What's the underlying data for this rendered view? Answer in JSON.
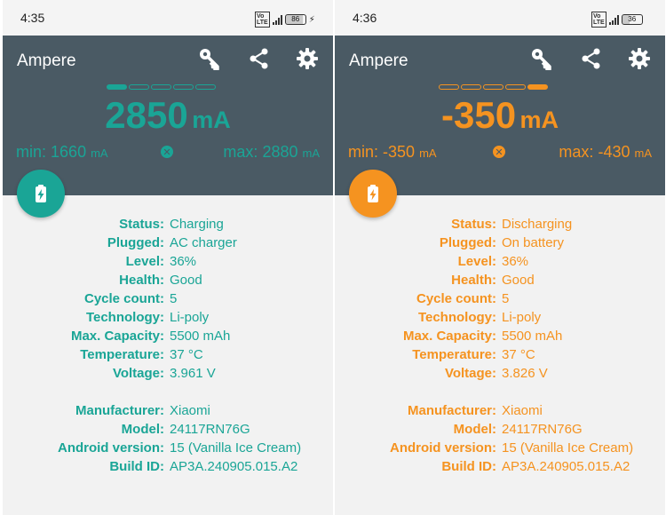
{
  "screens": [
    {
      "status_time": "4:35",
      "battery_indicator": "86",
      "battery_level_fraction": 0.86,
      "app_title": "Ampere",
      "accent": "#1aa596",
      "level_segments_filled": 1,
      "current_value": "2850",
      "current_unit": "mA",
      "min_label": "min:",
      "min_value": "1660",
      "min_unit": "mA",
      "max_label": "max:",
      "max_value": "2880",
      "max_unit": "mA",
      "status": "Charging",
      "plugged": "AC charger",
      "level": "36%",
      "health": "Good",
      "cycle_count": "5",
      "technology": "Li-poly",
      "max_capacity": "5500 mAh",
      "temperature": "37 °C",
      "voltage": "3.961 V",
      "manufacturer": "Xiaomi",
      "model": "24117RN76G",
      "android_version": "15 (Vanilla Ice Cream)",
      "build_id": "AP3A.240905.015.A2"
    },
    {
      "status_time": "4:36",
      "battery_indicator": "36",
      "battery_level_fraction": 0.36,
      "app_title": "Ampere",
      "accent": "#f59320",
      "level_segments_filled": 1,
      "current_value": "-350",
      "current_unit": "mA",
      "min_label": "min:",
      "min_value": "-350",
      "min_unit": "mA",
      "max_label": "max:",
      "max_value": "-430",
      "max_unit": "mA",
      "status": "Discharging",
      "plugged": "On battery",
      "level": "36%",
      "health": "Good",
      "cycle_count": "5",
      "technology": "Li-poly",
      "max_capacity": "5500 mAh",
      "temperature": "37 °C",
      "voltage": "3.826 V",
      "manufacturer": "Xiaomi",
      "model": "24117RN76G",
      "android_version": "15 (Vanilla Ice Cream)",
      "build_id": "AP3A.240905.015.A2"
    }
  ],
  "labels": {
    "status": "Status:",
    "plugged": "Plugged:",
    "level": "Level:",
    "health": "Health:",
    "cycle_count": "Cycle count:",
    "technology": "Technology:",
    "max_capacity": "Max. Capacity:",
    "temperature": "Temperature:",
    "voltage": "Voltage:",
    "manufacturer": "Manufacturer:",
    "model": "Model:",
    "android_version": "Android version:",
    "build_id": "Build ID:"
  },
  "icons": {
    "key": "key-icon",
    "share": "share-icon",
    "settings": "gear-icon",
    "reset": "close-circle-icon",
    "fab": "battery-charging-icon"
  }
}
